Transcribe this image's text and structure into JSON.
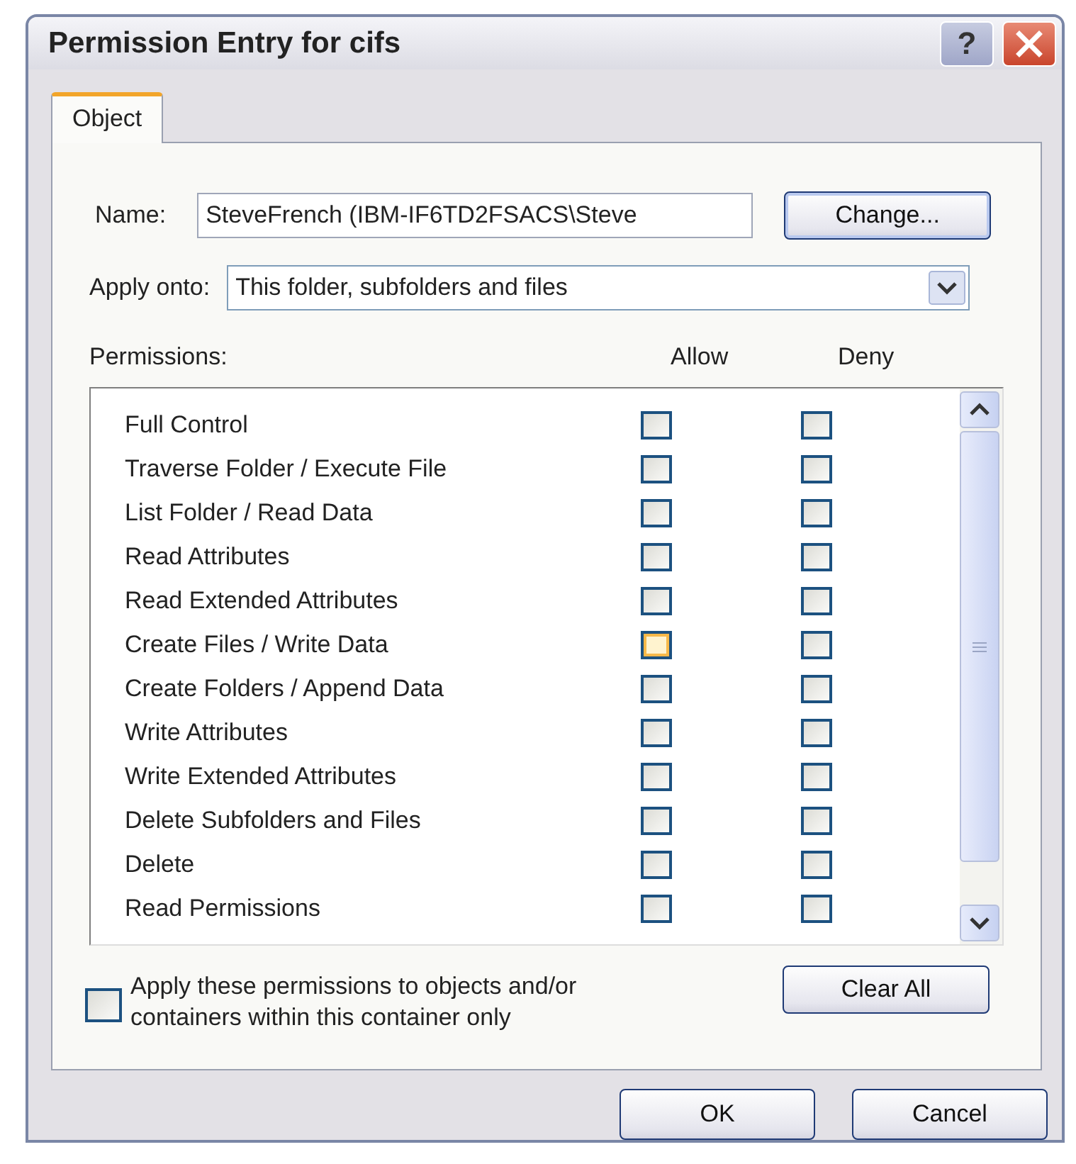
{
  "window": {
    "title": "Permission Entry for cifs",
    "help_button": "?"
  },
  "tabs": [
    {
      "label": "Object",
      "selected": true
    }
  ],
  "name_field": {
    "label": "Name:",
    "value": "SteveFrench (IBM-IF6TD2FSACS\\Steve",
    "button": "Change..."
  },
  "apply_onto": {
    "label": "Apply onto:",
    "value": "This folder, subfolders and files"
  },
  "permissions": {
    "label": "Permissions:",
    "columns": [
      "Allow",
      "Deny"
    ],
    "rows": [
      {
        "label": "Full Control",
        "allow": false,
        "deny": false,
        "hover": false
      },
      {
        "label": "Traverse Folder / Execute File",
        "allow": false,
        "deny": false,
        "hover": false
      },
      {
        "label": "List Folder / Read Data",
        "allow": false,
        "deny": false,
        "hover": false
      },
      {
        "label": "Read Attributes",
        "allow": false,
        "deny": false,
        "hover": false
      },
      {
        "label": "Read Extended Attributes",
        "allow": false,
        "deny": false,
        "hover": false
      },
      {
        "label": "Create Files / Write Data",
        "allow": false,
        "deny": false,
        "hover": true
      },
      {
        "label": "Create Folders / Append Data",
        "allow": false,
        "deny": false,
        "hover": false
      },
      {
        "label": "Write Attributes",
        "allow": false,
        "deny": false,
        "hover": false
      },
      {
        "label": "Write Extended Attributes",
        "allow": false,
        "deny": false,
        "hover": false
      },
      {
        "label": "Delete Subfolders and Files",
        "allow": false,
        "deny": false,
        "hover": false
      },
      {
        "label": "Delete",
        "allow": false,
        "deny": false,
        "hover": false
      },
      {
        "label": "Read Permissions",
        "allow": false,
        "deny": false,
        "hover": false
      }
    ]
  },
  "apply_within": {
    "label": "Apply these permissions to objects and/or containers within this container only",
    "checked": false
  },
  "clear_button": "Clear All",
  "buttons": [
    "OK",
    "Cancel"
  ]
}
